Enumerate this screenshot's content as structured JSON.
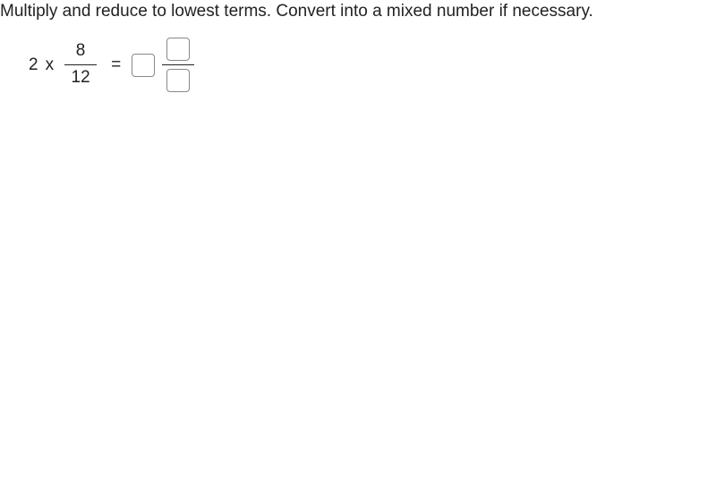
{
  "instruction": "Multiply and reduce to lowest terms. Convert into a mixed number if necessary.",
  "equation": {
    "left_whole": "2",
    "times": "x",
    "fraction": {
      "numerator": "8",
      "denominator": "12"
    },
    "equals": "="
  },
  "answer": {
    "whole_value": "",
    "numerator_value": "",
    "denominator_value": ""
  }
}
